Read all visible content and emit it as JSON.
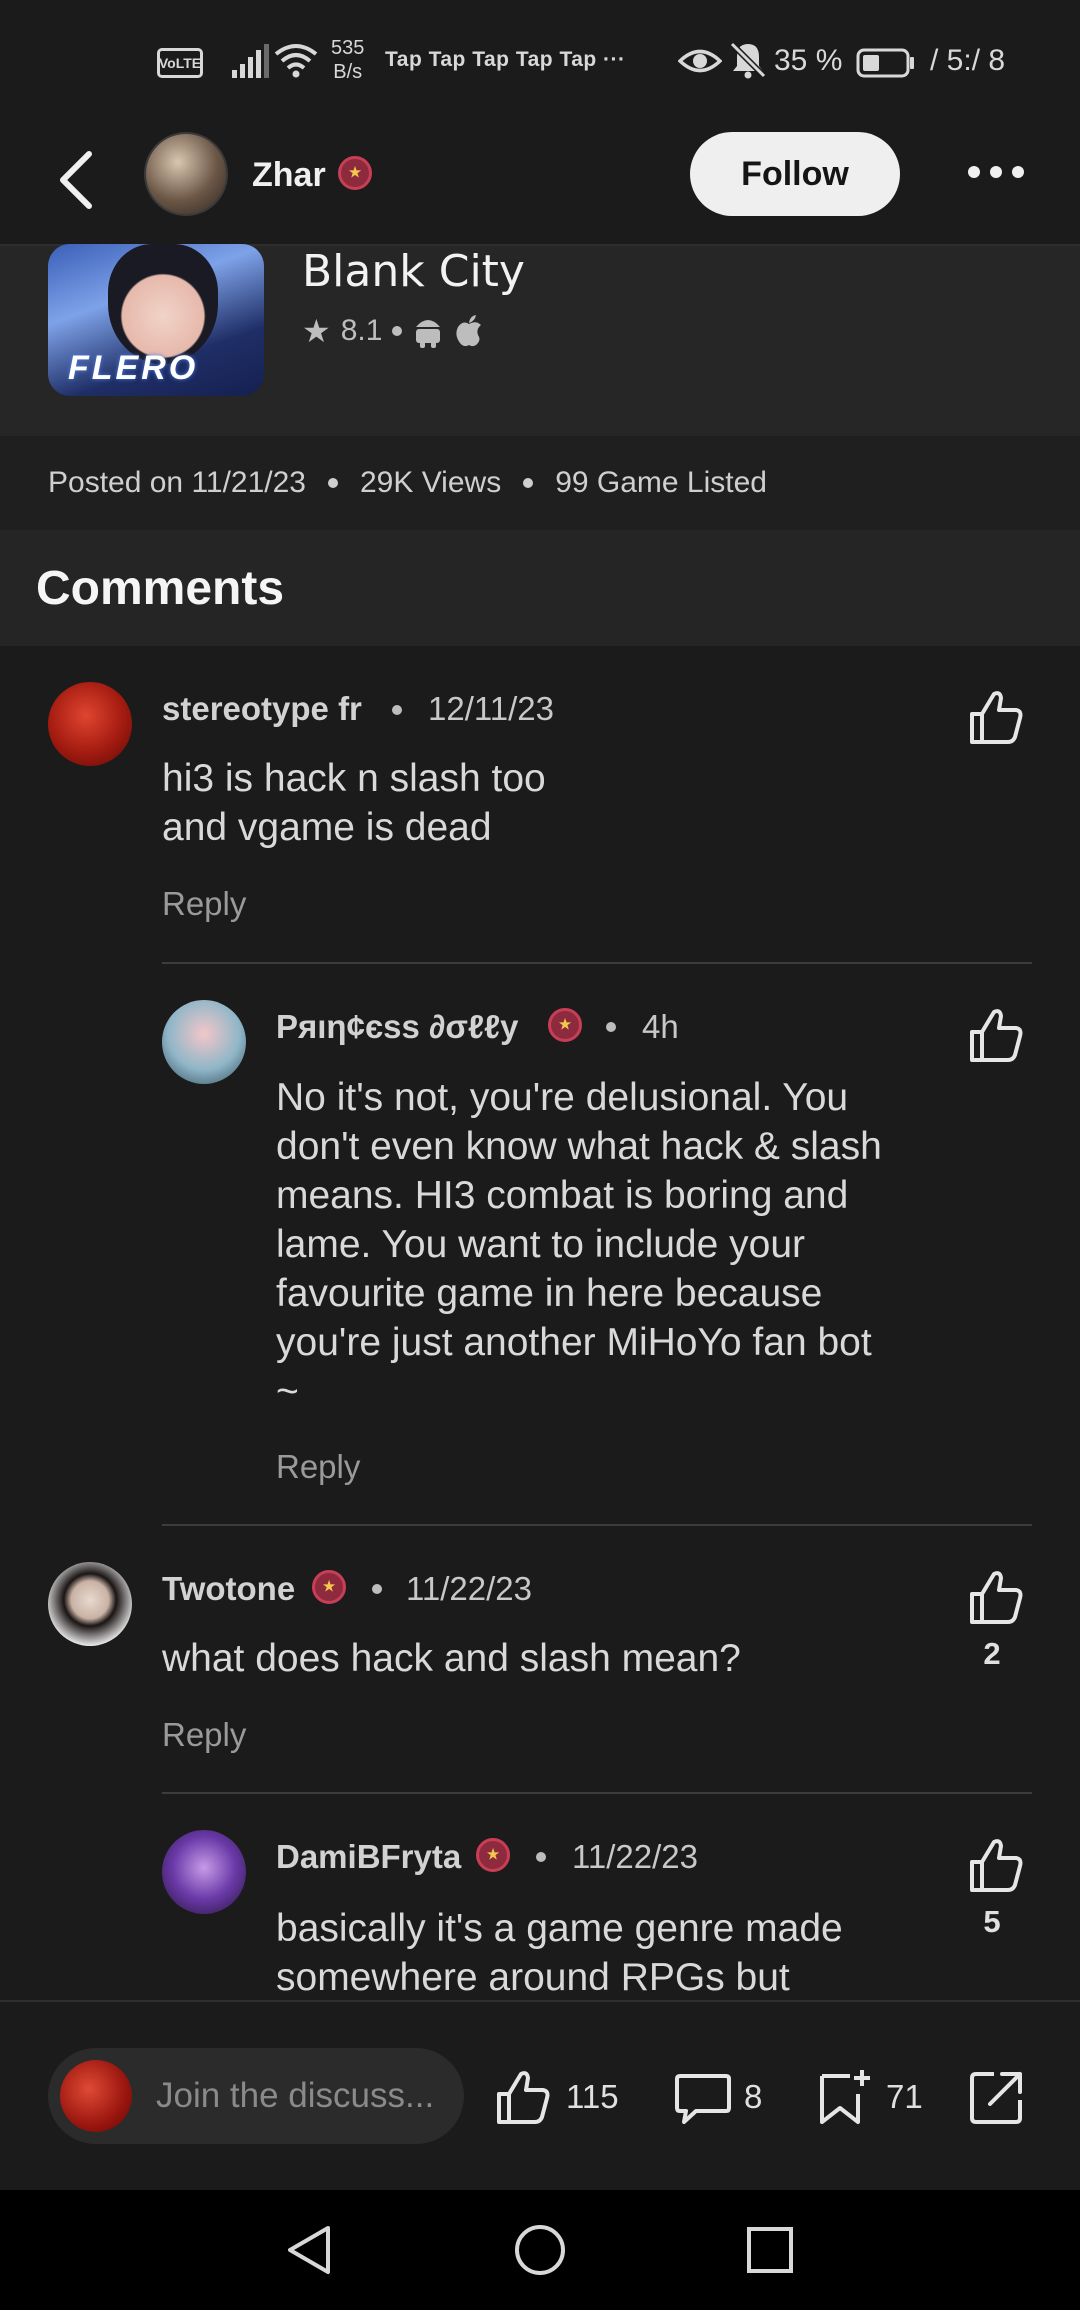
{
  "status_bar": {
    "volte": "VoLTE",
    "net_speed_value": "535",
    "net_speed_unit": "B/s",
    "notifications": "Tap Tap Tap Tap Tap ···",
    "battery_percent": "35 %",
    "time": "/ 5:/ 8"
  },
  "header": {
    "username": "Zhar",
    "follow_label": "Follow"
  },
  "game": {
    "title": "Blank City",
    "rating": "8.1",
    "icon_logo_text": "FLERO"
  },
  "meta": {
    "posted": "Posted on 11/21/23",
    "views": "29K  Views",
    "games_listed": "99 Game Listed"
  },
  "comments_heading": "Comments",
  "comments": [
    {
      "author": "stereotype fr",
      "date": "12/11/23",
      "text_lines": [
        "hi3 is hack n slash too",
        "and vgame is dead"
      ],
      "reply_label": "Reply",
      "likes": ""
    },
    {
      "author": "Pяıη¢єss ∂σℓℓу",
      "date": "4h",
      "text_lines": [
        "No it's not, you're delusional. You",
        "don't even know what hack & slash",
        "means. HI3 combat is boring and",
        "lame. You want to include your",
        "favourite game in here because",
        "you're just another MiHoYo fan bot",
        "~"
      ],
      "reply_label": "Reply",
      "likes": ""
    },
    {
      "author": "Twotone",
      "date": "11/22/23",
      "text_lines": [
        "what does hack and slash mean?"
      ],
      "reply_label": "Reply",
      "likes": "2"
    },
    {
      "author": "DamiBFryta",
      "date": "11/22/23",
      "text_lines": [
        "basically it's a game genre made",
        "somewhere around RPGs but"
      ],
      "reply_label": "",
      "likes": "5"
    }
  ],
  "bottom_bar": {
    "input_placeholder": "Join the discuss...",
    "likes": "115",
    "comments": "8",
    "saves": "71"
  },
  "icons": {
    "back": "back-arrow-icon",
    "more": "more-dots-icon",
    "like": "thumbs-up-icon",
    "comment": "comment-bubble-icon",
    "bookmark": "bookmark-plus-icon",
    "share": "share-icon",
    "android": "android-icon",
    "apple": "apple-icon",
    "star": "star-icon"
  },
  "colors": {
    "background": "#1b1b1c",
    "follow_button": "#efefef",
    "badge": "#8e2a3d",
    "badge_star": "#f2c94c"
  }
}
